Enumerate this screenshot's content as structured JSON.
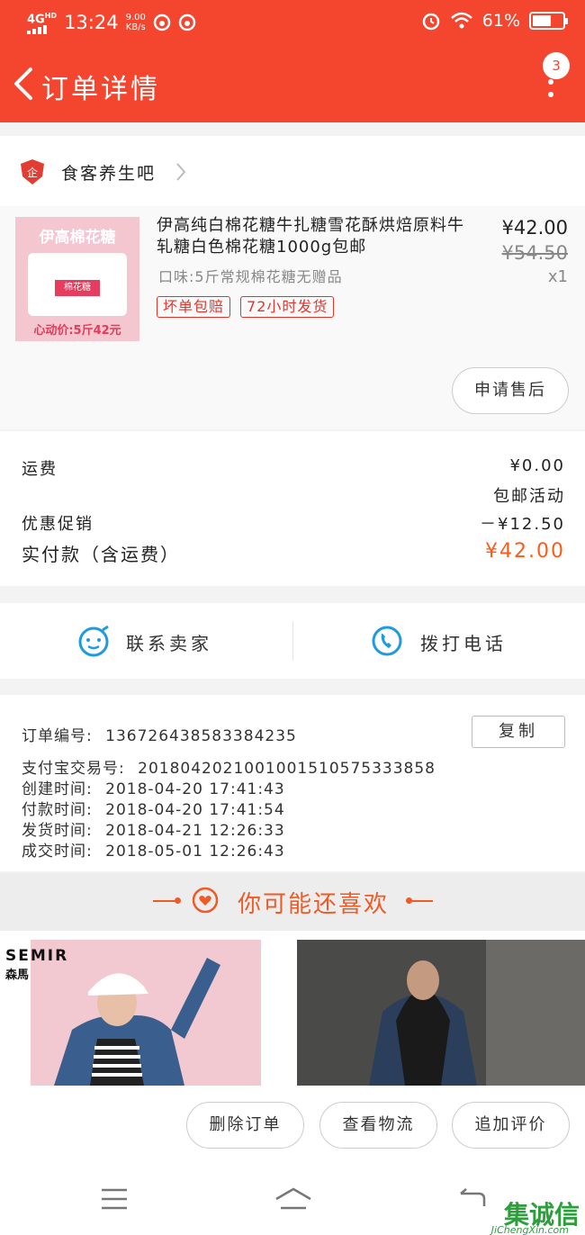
{
  "status_bar": {
    "network": "4G",
    "network_sup": "HD",
    "time": "13:24",
    "speed_value": "9.00",
    "speed_unit": "KB/s",
    "battery_percent": "61%",
    "battery_level": 0.61
  },
  "header": {
    "title": "订单详情",
    "badge_count": "3"
  },
  "store": {
    "name": "食客养生吧"
  },
  "product": {
    "title": "伊高纯白棉花糖牛扎糖雪花酥烘焙原料牛轧糖白色棉花糖1000g包邮",
    "spec": "口味:5斤常规棉花糖无赠品",
    "tags": [
      "坏单包赔",
      "72小时发货"
    ],
    "price": "¥42.00",
    "original_price": "¥54.50",
    "quantity": "x1",
    "image_brand_text": "伊高棉花糖",
    "image_label_text": "棉花糖",
    "image_promo_text": "心动价:5斤42元",
    "after_sale_label": "申请售后"
  },
  "fees": {
    "shipping_label": "运费",
    "shipping_value": "¥0.00",
    "shipping_note": "包邮活动",
    "discount_label": "优惠促销",
    "discount_value": "－¥12.50",
    "total_label": "实付款（含运费）",
    "total_value": "¥42.00"
  },
  "contact": {
    "seller_label": "联系卖家",
    "phone_label": "拨打电话"
  },
  "order_info": {
    "order_no_label": "订单编号:",
    "order_no": "136726438583384235",
    "alipay_label": "支付宝交易号:",
    "alipay_no": "2018042021001001510575333858",
    "created_label": "创建时间:",
    "created": "2018-04-20 17:41:43",
    "paid_label": "付款时间:",
    "paid": "2018-04-20 17:41:54",
    "shipped_label": "发货时间:",
    "shipped": "2018-04-21 12:26:33",
    "completed_label": "成交时间:",
    "completed": "2018-05-01 12:26:43",
    "copy_label": "复制"
  },
  "recommend": {
    "title": "你可能还喜欢",
    "brand_en": "SEMIR",
    "brand_cn": "森馬"
  },
  "actions": {
    "delete_label": "删除订单",
    "logistics_label": "查看物流",
    "review_label": "追加评价"
  },
  "watermark": {
    "text": "集诚信",
    "url": "JiChengXin.com"
  },
  "colors": {
    "brand": "#f4462f",
    "accent_orange": "#ff5a17",
    "tag_red": "#e2342b",
    "contact_blue": "#1e9be0"
  }
}
